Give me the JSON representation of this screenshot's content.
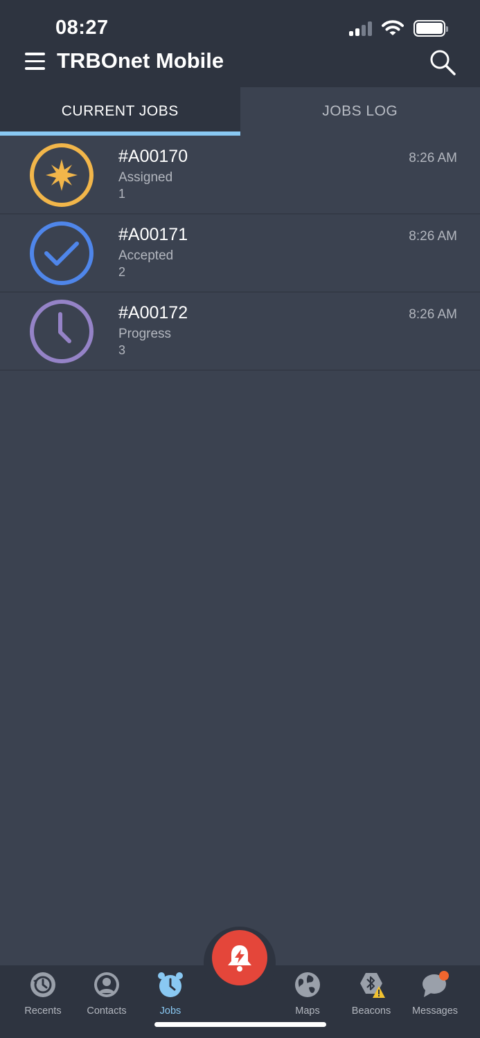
{
  "status_bar": {
    "time": "08:27"
  },
  "header": {
    "title": "TRBOnet Mobile"
  },
  "tabs": [
    {
      "label": "CURRENT JOBS",
      "active": true
    },
    {
      "label": "JOBS LOG",
      "active": false
    }
  ],
  "jobs": [
    {
      "id": "#A00170",
      "status": "Assigned",
      "number": "1",
      "time": "8:26 AM",
      "icon": "star-icon",
      "color": "#f2b64a"
    },
    {
      "id": "#A00171",
      "status": "Accepted",
      "number": "2",
      "time": "8:26 AM",
      "icon": "check-icon",
      "color": "#4f86ea"
    },
    {
      "id": "#A00172",
      "status": "Progress",
      "number": "3",
      "time": "8:26 AM",
      "icon": "clock-icon",
      "color": "#9583c7"
    }
  ],
  "bottom_nav": {
    "items": [
      {
        "label": "Recents",
        "icon": "history-icon"
      },
      {
        "label": "Contacts",
        "icon": "person-icon"
      },
      {
        "label": "Jobs",
        "icon": "alarm-clock-icon",
        "active": true
      },
      {
        "label": "Maps",
        "icon": "globe-icon"
      },
      {
        "label": "Beacons",
        "icon": "bluetooth-warning-icon"
      },
      {
        "label": "Messages",
        "icon": "chat-bubble-icon"
      }
    ],
    "alarm_icon": "alarm-bell-icon"
  },
  "colors": {
    "background": "#3b4250",
    "header": "#2e3440",
    "accent": "#89c8f2",
    "alarm": "#e4463a",
    "notification": "#f0662e"
  }
}
